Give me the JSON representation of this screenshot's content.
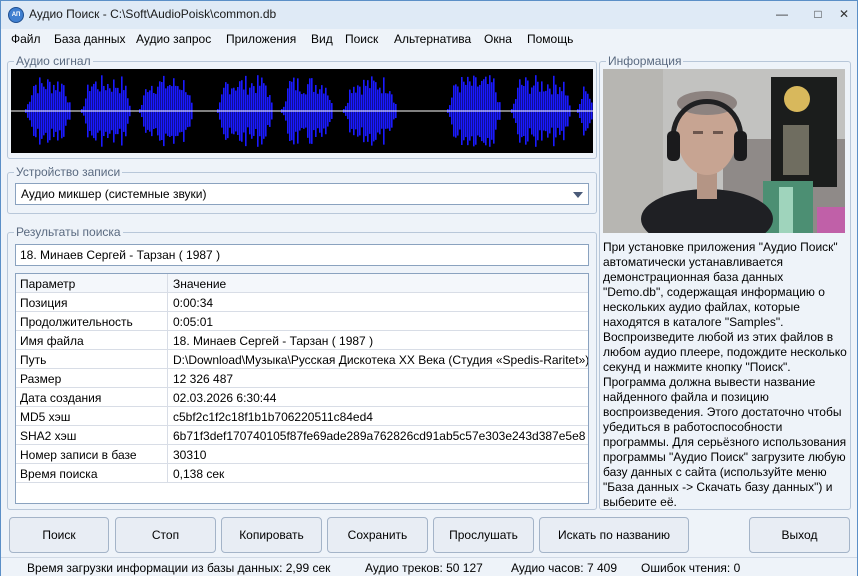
{
  "window": {
    "title": "Аудио Поиск - C:\\Soft\\AudioPoisk\\common.db",
    "icon_text": "АП"
  },
  "menu": [
    "Файл",
    "База данных",
    "Аудио запрос",
    "Приложения",
    "Вид",
    "Поиск",
    "Альтернатива",
    "Окна",
    "Помощь"
  ],
  "audio_signal": {
    "label": "Аудио сигнал",
    "background": "#000000",
    "waveform_color": "#1a1aff",
    "center_line_color": "#ffffff"
  },
  "record_device": {
    "label": "Устройство записи",
    "selected": "Аудио микшер (системные звуки)"
  },
  "results": {
    "label": "Результаты поиска",
    "found": "18. Минаев Сергей - Тарзан ( 1987 )",
    "columns": [
      "Параметр",
      "Значение"
    ],
    "rows": [
      [
        "Позиция",
        "0:00:34"
      ],
      [
        "Продолжительность",
        "0:05:01"
      ],
      [
        "Имя файла",
        "18. Минаев Сергей - Тарзан ( 1987 )"
      ],
      [
        "Путь",
        "D:\\Download\\Музыка\\Русская Дискотека XX Века (Студия «Spedis-Raritet»)\\Р"
      ],
      [
        "Размер",
        "12 326 487"
      ],
      [
        "Дата создания",
        "02.03.2026 6:30:44"
      ],
      [
        "MD5 хэш",
        "c5bf2c1f2c18f1b1b706220511c84ed4"
      ],
      [
        "SHA2 хэш",
        "6b71f3def170740105f87fe69ade289a762826cd91ab5c57e303e243d387e5e8"
      ],
      [
        "Номер записи в базе",
        "30310"
      ],
      [
        "Время поиска",
        "0,138 сек"
      ]
    ]
  },
  "info": {
    "label": "Информация",
    "text": "При установке приложения \"Аудио Поиск\" автоматически устанавливается демонстрационная база данных \"Demo.db\", содержащая информацию о нескольких аудио файлах, которые находятся в каталоге \"Samples\". Воспроизведите любой из этих файлов в любом аудио плеере, подождите несколько секунд и нажмите кнопку \"Поиск\". Программа должна вывести название найденного файла и позицию воспроизведения. Этого достаточно чтобы убедиться в работоспособности программы. Для серьёзного использования программы \"Аудио Поиск\" загрузите любую базу данных с сайта (используйте меню \"База данных -> Скачать базу данных\") и выберите её."
  },
  "buttons": {
    "search": "Поиск",
    "stop": "Стоп",
    "copy": "Копировать",
    "save": "Сохранить",
    "listen": "Прослушать",
    "search_by_name": "Искать по названию",
    "exit": "Выход"
  },
  "status": {
    "load_time": "Время загрузки информации из базы данных: 2,99 сек",
    "tracks": "Аудио треков: 50 127",
    "hours": "Аудио часов: 7 409",
    "errors": "Ошибок чтения: 0"
  }
}
